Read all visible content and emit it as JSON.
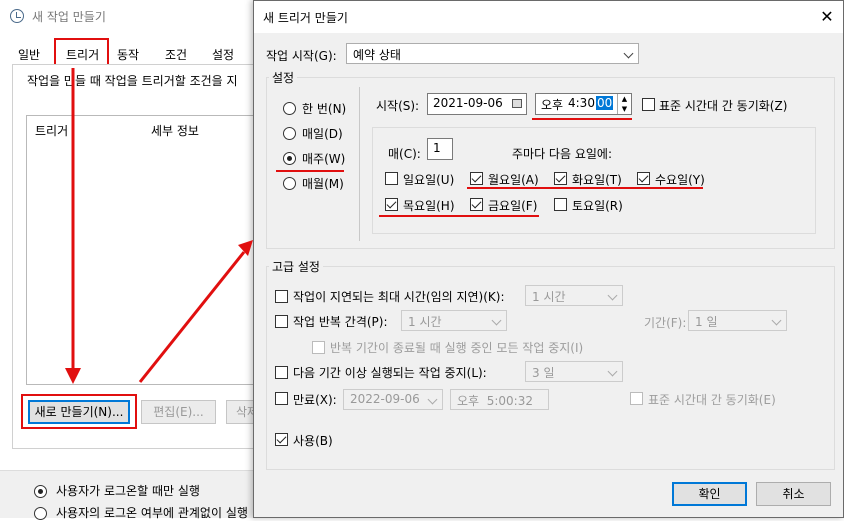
{
  "bg": {
    "title": "새 작업 만들기",
    "tabs": [
      "일반",
      "트리거",
      "동작",
      "조건",
      "설정"
    ],
    "description": "작업을 만들 때 작업을 트리거할 조건을 지",
    "table_headers": [
      "트리거",
      "세부 정보"
    ],
    "buttons": {
      "new": "새로 만들기(N)...",
      "edit": "편집(E)...",
      "delete": "삭제"
    },
    "run_options": [
      "사용자가 로그온할 때만 실행",
      "사용자의 로그온 여부에 관계없이 실행"
    ]
  },
  "dialog": {
    "title": "새 트리거 만들기",
    "start_task_label": "작업 시작(G):",
    "start_task_value": "예약 상태",
    "settings_group": "설정",
    "schedule_options": [
      "한 번(N)",
      "매일(D)",
      "매주(W)",
      "매월(M)"
    ],
    "selected_schedule": "매주(W)",
    "start_label": "시작(S):",
    "start_date": "2021-09-06",
    "start_time_ampm": "오후",
    "start_time_rest": "4:30:",
    "start_time_selected": "00",
    "sync_tz_label": "표준 시간대 간 동기화(Z)",
    "recur_label": "매(C):",
    "recur_value": "1",
    "recur_suffix": "주마다 다음 요일에:",
    "days": [
      {
        "label": "일요일(U)",
        "checked": false
      },
      {
        "label": "월요일(A)",
        "checked": true
      },
      {
        "label": "화요일(T)",
        "checked": true
      },
      {
        "label": "수요일(Y)",
        "checked": true
      },
      {
        "label": "목요일(H)",
        "checked": true
      },
      {
        "label": "금요일(F)",
        "checked": true
      },
      {
        "label": "토요일(R)",
        "checked": false
      }
    ],
    "advanced": {
      "group": "고급 설정",
      "delay_label": "작업이 지연되는 최대 시간(임의 지연)(K):",
      "delay_value": "1 시간",
      "repeat_label": "작업 반복 간격(P):",
      "repeat_value": "1 시간",
      "duration_label": "기간(F):",
      "duration_value": "1 일",
      "stop_repeat_label": "반복 기간이 종료될 때 실행 중인 모든 작업 중지(I)",
      "stop_long_label": "다음 기간 이상 실행되는 작업 중지(L):",
      "stop_long_value": "3 일",
      "expire_label": "만료(X):",
      "expire_date": "2022-09-06",
      "expire_time": "오후  5:00:32",
      "expire_sync_label": "표준 시간대 간 동기화(E)",
      "enabled_label": "사용(B)"
    },
    "ok": "확인",
    "cancel": "취소",
    "close_glyph": "✕"
  },
  "colors": {
    "annotation_red": "#e10f0f",
    "selection_blue": "#0078d7"
  }
}
